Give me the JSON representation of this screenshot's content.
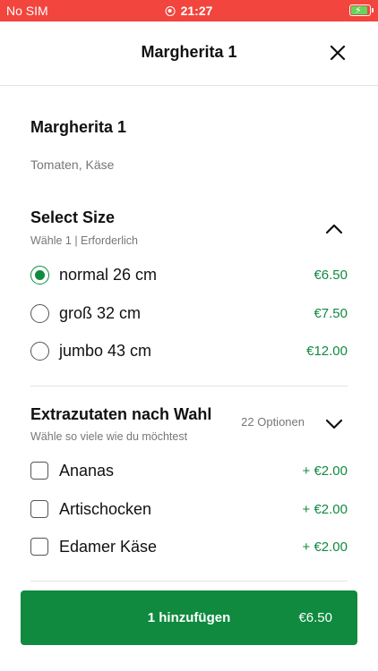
{
  "status_bar": {
    "carrier": "No SIM",
    "time": "21:27"
  },
  "header": {
    "title": "Margherita 1"
  },
  "product": {
    "name": "Margherita 1",
    "description": "Tomaten, Käse"
  },
  "size_section": {
    "title": "Select Size",
    "subtitle": "Wähle 1  |  Erforderlich",
    "options": [
      {
        "label": "normal 26 cm",
        "price": "€6.50",
        "selected": true
      },
      {
        "label": "groß 32 cm",
        "price": "€7.50",
        "selected": false
      },
      {
        "label": "jumbo 43 cm",
        "price": "€12.00",
        "selected": false
      }
    ]
  },
  "extras_section": {
    "title": "Extrazutaten nach Wahl",
    "subtitle": "Wähle so viele wie du möchtest",
    "count": "22 Optionen",
    "options": [
      {
        "label": "Ananas",
        "price": "+ €2.00",
        "checked": false
      },
      {
        "label": "Artischocken",
        "price": "+ €2.00",
        "checked": false
      },
      {
        "label": "Edamer Käse",
        "price": "+ €2.00",
        "checked": false
      }
    ]
  },
  "add_button": {
    "label": "1 hinzufügen",
    "price": "€6.50"
  },
  "colors": {
    "accent": "#0f8a3f",
    "status_bar": "#f2453d"
  }
}
